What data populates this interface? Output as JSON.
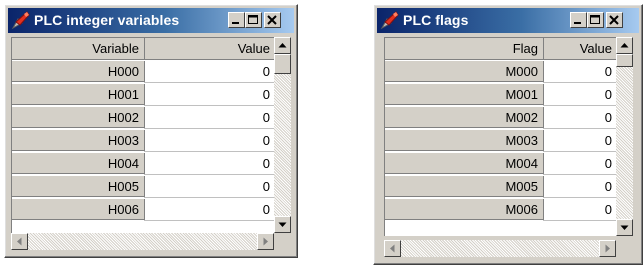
{
  "windows": [
    {
      "title": "PLC integer variables",
      "header_name": "Variable",
      "header_value": "Value",
      "rows": [
        {
          "name": "H000",
          "value": "0"
        },
        {
          "name": "H001",
          "value": "0"
        },
        {
          "name": "H002",
          "value": "0"
        },
        {
          "name": "H003",
          "value": "0"
        },
        {
          "name": "H004",
          "value": "0"
        },
        {
          "name": "H005",
          "value": "0"
        },
        {
          "name": "H006",
          "value": "0"
        }
      ]
    },
    {
      "title": "PLC flags",
      "header_name": "Flag",
      "header_value": "Value",
      "rows": [
        {
          "name": "M000",
          "value": "0"
        },
        {
          "name": "M001",
          "value": "0"
        },
        {
          "name": "M002",
          "value": "0"
        },
        {
          "name": "M003",
          "value": "0"
        },
        {
          "name": "M004",
          "value": "0"
        },
        {
          "name": "M005",
          "value": "0"
        },
        {
          "name": "M006",
          "value": "0"
        }
      ]
    }
  ]
}
